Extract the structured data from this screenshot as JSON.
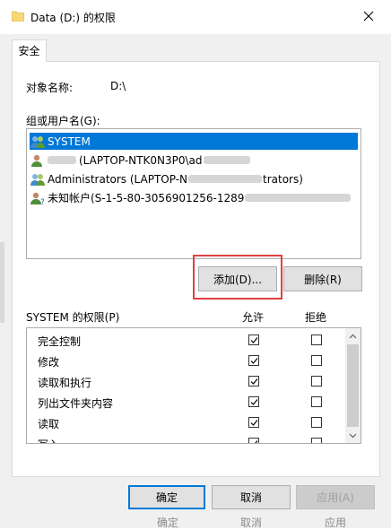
{
  "window": {
    "title": "Data (D:) 的权限",
    "icon": "folder-icon",
    "close_icon": "close-icon"
  },
  "tab": {
    "label": "安全"
  },
  "object": {
    "label": "对象名称:",
    "value": "D:\\"
  },
  "groups": {
    "label": "组或用户名(G):",
    "items": [
      {
        "name": "SYSTEM",
        "icon": "users-group-icon",
        "selected": true,
        "prefix_visible": "",
        "suffix_visible": ""
      },
      {
        "name": "(LAPTOP-NTK0N3P0\\ad",
        "icon": "user-icon",
        "selected": false
      },
      {
        "name": "Administrators (LAPTOP-N",
        "suffix": "trators)",
        "icon": "users-group-icon",
        "selected": false
      },
      {
        "name": "未知帐户(S-1-5-80-3056901256-1289",
        "icon": "unknown-user-icon",
        "selected": false
      }
    ]
  },
  "buttons": {
    "add": "添加(D)...",
    "remove": "删除(R)",
    "ok": "确定",
    "cancel": "取消",
    "apply": "应用(A)"
  },
  "permissions": {
    "label": "SYSTEM 的权限(P)",
    "allow_header": "允许",
    "deny_header": "拒绝",
    "rows": [
      {
        "name": "完全控制",
        "allow": true,
        "deny": false
      },
      {
        "name": "修改",
        "allow": true,
        "deny": false
      },
      {
        "name": "读取和执行",
        "allow": true,
        "deny": false
      },
      {
        "name": "列出文件夹内容",
        "allow": true,
        "deny": false
      },
      {
        "name": "读取",
        "allow": true,
        "deny": false
      },
      {
        "name": "写入",
        "allow": true,
        "deny": false
      }
    ]
  },
  "background_footer": [
    "确定",
    "取消",
    "应用"
  ],
  "colors": {
    "selection": "#0078d7",
    "highlight_box": "#e04040"
  }
}
